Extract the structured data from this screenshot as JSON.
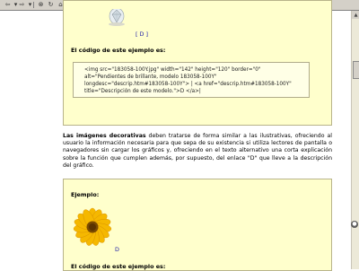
{
  "toolbar": {
    "buttons": [
      {
        "name": "back-button",
        "icon": "back-arrow-icon",
        "glyph": "⇦"
      },
      {
        "name": "back-dropdown",
        "icon": "chevron-down-icon",
        "glyph": "▾"
      },
      {
        "name": "forward-button",
        "icon": "forward-arrow-icon",
        "glyph": "⇨"
      },
      {
        "name": "forward-dropdown",
        "icon": "chevron-down-icon",
        "glyph": "▾"
      },
      {
        "name": "stop-button",
        "icon": "stop-icon",
        "glyph": "⊗"
      },
      {
        "name": "refresh-button",
        "icon": "refresh-icon",
        "glyph": "↻"
      },
      {
        "name": "home-button",
        "icon": "home-icon",
        "glyph": "⌂"
      },
      {
        "name": "search-button",
        "icon": "search-icon",
        "glyph": "⚲"
      },
      {
        "name": "favorites-button",
        "icon": "favorites-icon",
        "glyph": "★"
      },
      {
        "name": "history-button",
        "icon": "history-icon",
        "glyph": "◷"
      },
      {
        "name": "mail-button",
        "icon": "mail-icon",
        "glyph": "✉"
      },
      {
        "name": "print-button",
        "icon": "print-icon",
        "glyph": "⎙"
      },
      {
        "name": "edit-button",
        "icon": "edit-icon",
        "glyph": "✎"
      },
      {
        "name": "discuss-button",
        "icon": "discuss-icon",
        "glyph": "▤"
      },
      {
        "name": "messenger-button",
        "icon": "messenger-icon",
        "glyph": "☺"
      },
      {
        "name": "media-button",
        "icon": "media-icon",
        "glyph": "♪"
      },
      {
        "name": "extra-button",
        "icon": "tools-icon",
        "glyph": "⚙"
      }
    ]
  },
  "panel1": {
    "d_link": "[ D ]",
    "code_heading": "El código de este ejemplo es:",
    "code": "<img src=\"183058-100Y.jpg\" width=\"142\" height=\"120\" border=\"0\"\nalt=\"Pendientes de brillante, modelo 183058-100Y\"\nlongdesc=\"descrip.htm#183058-100Y\"> | <a href=\"descrip.htm#183058-100Y\"\ntitle=\"Descripción de este modelo.\">D </a>|"
  },
  "paragraph": {
    "bold_lead": "Las imágenes decorativas",
    "rest": " deben tratarse de forma similar a las ilustrativas, ofreciendo al usuario la información necesaria para que sepa de su existencia si utiliza lectores de pantalla o navegadores sin cargar los gráficos y, ofreciendo en el texto alternativo una corta explicación sobre la función que cumplen además, por supuesto, del enlace \"D\" que lleve a la descripción del gráfico."
  },
  "panel2": {
    "example_label": "Ejemplo:",
    "d_link": "D",
    "code_heading": "El código de este ejemplo es:"
  },
  "colors": {
    "panel_bg": "#ffffcc",
    "link": "#1a1aa6",
    "toolbar_bg": "#d4d0c8"
  }
}
